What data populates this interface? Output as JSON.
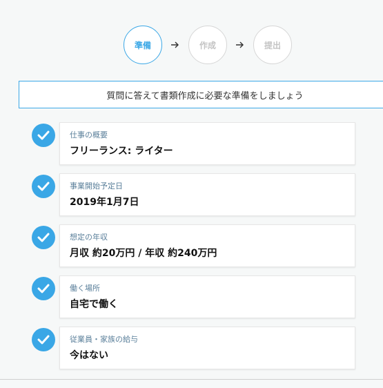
{
  "stepper": {
    "steps": [
      {
        "label": "準備",
        "state": "active"
      },
      {
        "label": "作成",
        "state": "inactive"
      },
      {
        "label": "提出",
        "state": "inactive"
      }
    ],
    "arrow_icon": "arrow-right-icon"
  },
  "banner": {
    "text": "質問に答えて書類作成に必要な準備をしましょう"
  },
  "checklist": [
    {
      "label": "仕事の概要",
      "value": "フリーランス: ライター",
      "icon": "check-circle-icon"
    },
    {
      "label": "事業開始予定日",
      "value": "2019年1月7日",
      "icon": "check-circle-icon"
    },
    {
      "label": "想定の年収",
      "value": "月収 約20万円 / 年収 約240万円",
      "icon": "check-circle-icon"
    },
    {
      "label": "働く場所",
      "value": "自宅で働く",
      "icon": "check-circle-icon"
    },
    {
      "label": "従業員・家族の給与",
      "value": "今はない",
      "icon": "check-circle-icon"
    }
  ],
  "colors": {
    "accent": "#3aa7e6",
    "label": "#5a7f9a",
    "inactive_step": "#c4c4c4"
  }
}
